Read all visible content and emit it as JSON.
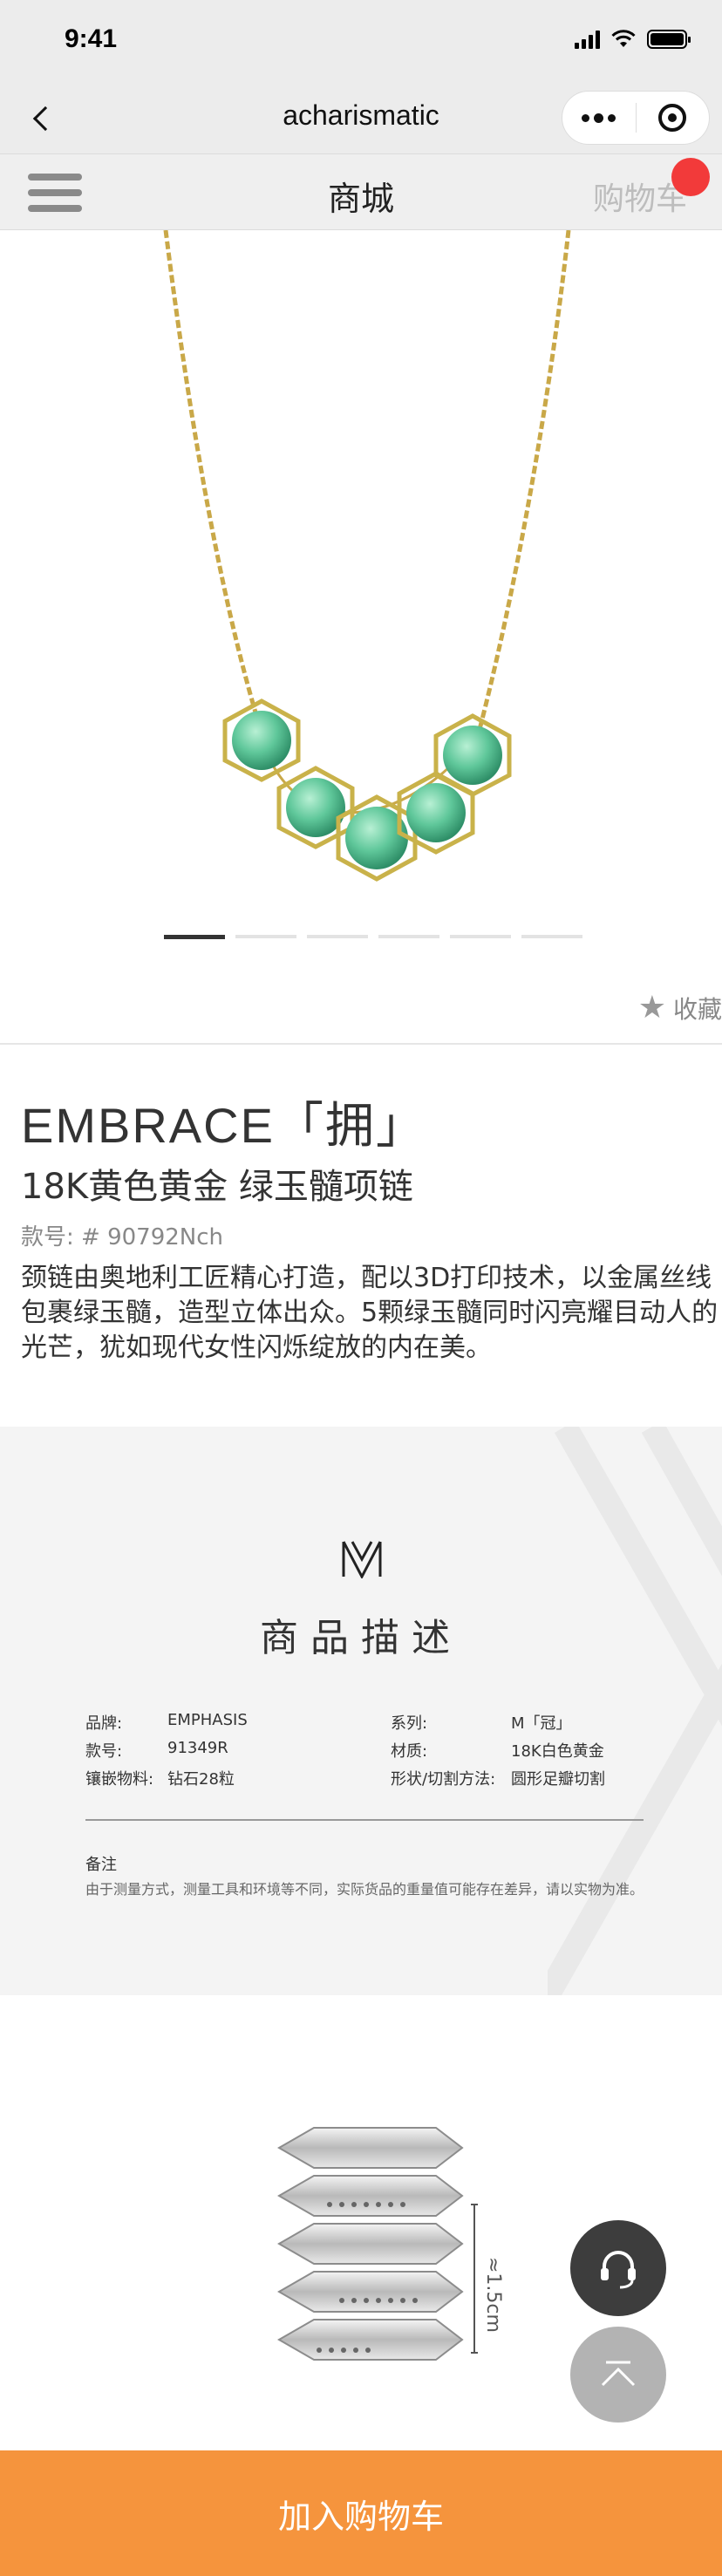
{
  "status_bar": {
    "time": "9:41"
  },
  "title_bar": {
    "title": "acharismatic"
  },
  "shop_nav": {
    "title": "商城",
    "cart_label": "购物车"
  },
  "gallery": {
    "slide_count": 6,
    "active_index": 0
  },
  "favorite": {
    "label": "收藏"
  },
  "product": {
    "name": "EMBRACE「拥」",
    "subtitle": "18K黄色黄金 绿玉髓项链",
    "code": "款号: # 90792Nch",
    "description": "颈链由奥地利工匠精心打造，配以3D打印技术，以金属丝线包裹绿玉髓，造型立体出众。5颗绿玉髓同时闪亮耀目动人的光芒，犹如现代女性闪烁绽放的内在美。"
  },
  "description_block": {
    "heading": "商品描述",
    "specs": [
      {
        "k1": "品牌:",
        "v1": "EMPHASIS",
        "k2": "系列:",
        "v2": "M「冠」"
      },
      {
        "k1": "款号:",
        "v1": "91349R",
        "k2": "材质:",
        "v2": "18K白色黄金"
      },
      {
        "k1": "镶嵌物料:",
        "v1": "钻石28粒",
        "k2": "形状/切割方法:",
        "v2": "圆形足瓣切割"
      }
    ],
    "note_title": "备注",
    "note_text": "由于测量方式，测量工具和环境等不同，实际货品的重量值可能存在差异，请以实物为准。"
  },
  "ring_dimension": "≈1.5cm",
  "bottom_bar": {
    "add_to_cart": "加入购物车"
  },
  "colors": {
    "accent": "#f5943d",
    "badge": "#f23a3a",
    "chain": "#c9a848",
    "stone": "#5fc79a"
  }
}
